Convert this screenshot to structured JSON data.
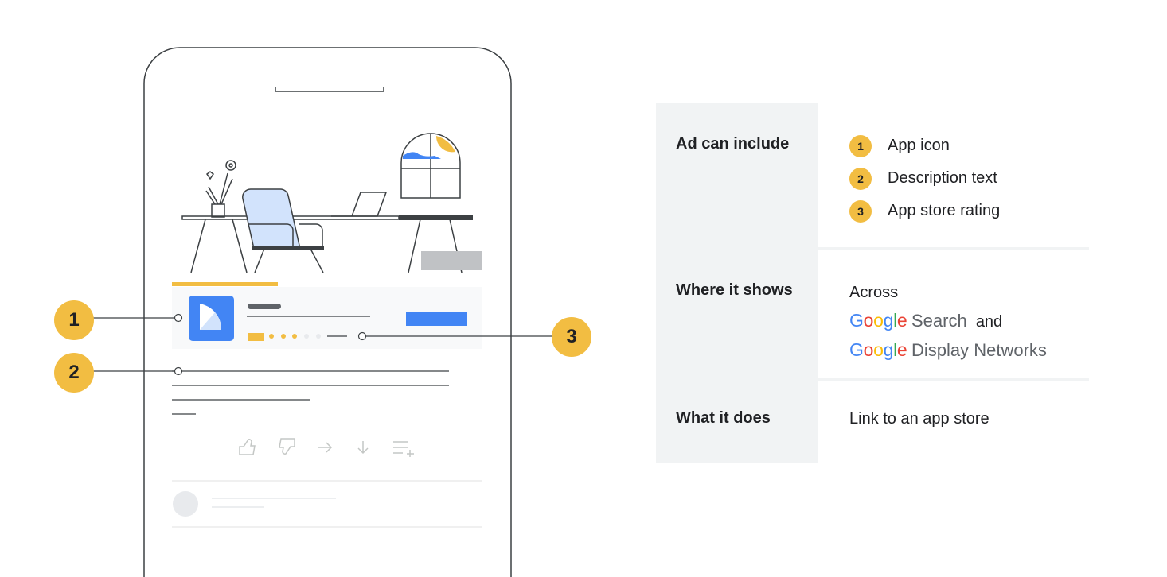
{
  "callouts": [
    "1",
    "2",
    "3"
  ],
  "table": {
    "rows": [
      {
        "label": "Ad can include",
        "items": [
          {
            "num": "1",
            "text": "App icon"
          },
          {
            "num": "2",
            "text": "Description text"
          },
          {
            "num": "3",
            "text": "App store rating"
          }
        ]
      },
      {
        "label": "Where it shows",
        "line1": "Across",
        "google1": "Google",
        "network1": "Search",
        "and": "and",
        "google2": "Google",
        "network2": "Display Networks"
      },
      {
        "label": "What it does",
        "text": "Link to an app store"
      }
    ]
  },
  "colors": {
    "accent_yellow": "#f2bd42",
    "google_blue": "#4285f4",
    "label_bg": "#f1f3f4"
  }
}
